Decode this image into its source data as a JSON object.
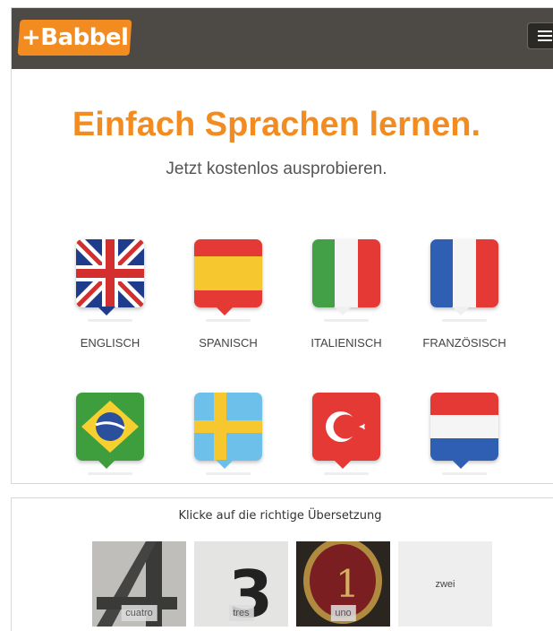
{
  "header": {
    "logo_text": "+Babbel",
    "logo_color": "#f28c21",
    "bar_color": "#4d4a45",
    "menu_icon": "hamburger-menu-icon"
  },
  "hero": {
    "headline": "Einfach Sprachen lernen.",
    "subline": "Jetzt kostenlos ausprobieren."
  },
  "languages": [
    {
      "label": "ENGLISCH",
      "flag": "uk-flag-icon"
    },
    {
      "label": "SPANISCH",
      "flag": "spain-flag-icon"
    },
    {
      "label": "ITALIENISCH",
      "flag": "italy-flag-icon"
    },
    {
      "label": "FRANZÖSISCH",
      "flag": "france-flag-icon"
    },
    {
      "label": "",
      "flag": "brazil-flag-icon"
    },
    {
      "label": "",
      "flag": "sweden-flag-icon"
    },
    {
      "label": "",
      "flag": "turkey-flag-icon"
    },
    {
      "label": "",
      "flag": "netherlands-flag-icon"
    }
  ],
  "quiz": {
    "title": "Klicke auf die richtige Übersetzung",
    "options": [
      {
        "label": "cuatro"
      },
      {
        "label": "tres"
      },
      {
        "label": "uno"
      },
      {
        "label": "zwei"
      }
    ]
  }
}
